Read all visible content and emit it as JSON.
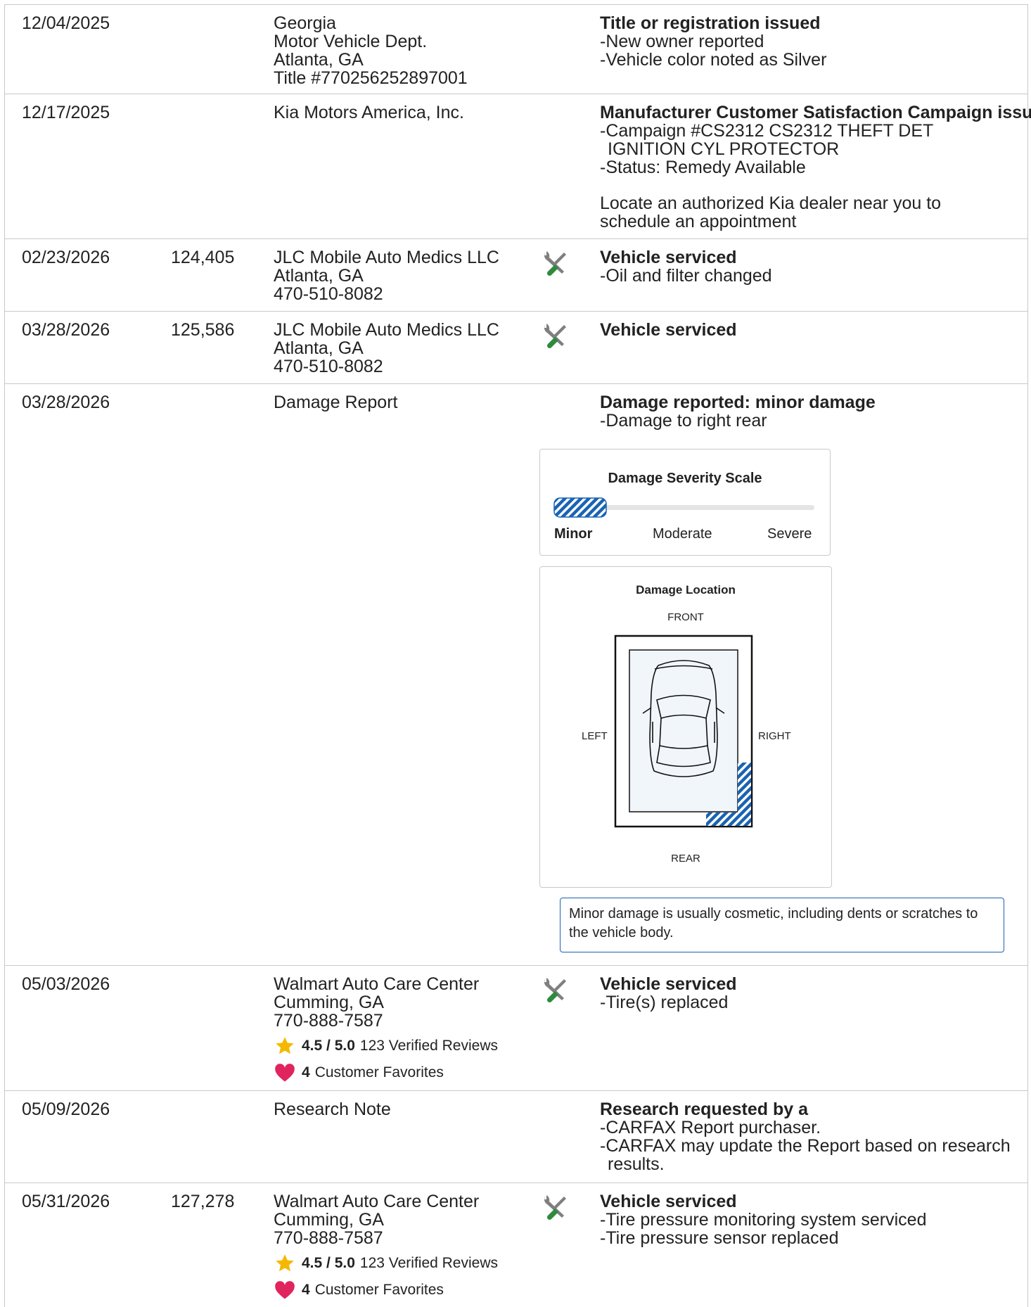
{
  "rows": [
    {
      "date": "12/04/2025",
      "odometer": "",
      "source": [
        "Georgia",
        "Motor Vehicle Dept.",
        "Atlanta, GA",
        "Title #770256252897001"
      ],
      "has_icon": false,
      "heading": "Title or registration issued",
      "bullets": [
        "New owner reported",
        "Vehicle color noted as Silver"
      ]
    },
    {
      "date": "12/17/2025",
      "odometer": "",
      "source": [
        "Kia Motors America, Inc."
      ],
      "has_icon": false,
      "heading": "Manufacturer Customer Satisfaction Campaign issued",
      "bullets": [
        "Campaign #CS2312 CS2312 THEFT DET IGNITION CYL PROTECTOR",
        "Status: Remedy Available"
      ],
      "extra": "Locate an authorized Kia dealer near you to schedule an appointment"
    },
    {
      "date": "02/23/2026",
      "odometer": "124,405",
      "source": [
        "JLC Mobile Auto Medics LLC",
        "Atlanta, GA",
        "470-510-8082"
      ],
      "has_icon": true,
      "heading": "Vehicle serviced",
      "bullets": [
        "Oil and filter changed"
      ]
    },
    {
      "date": "03/28/2026",
      "odometer": "125,586",
      "source": [
        "JLC Mobile Auto Medics LLC",
        "Atlanta, GA",
        "470-510-8082"
      ],
      "has_icon": true,
      "heading": "Vehicle serviced",
      "bullets": []
    },
    {
      "date": "03/28/2026",
      "odometer": "",
      "source": [
        "Damage Report"
      ],
      "has_icon": false,
      "heading": "Damage reported: minor damage",
      "bullets": [
        "Damage to right rear"
      ]
    },
    {
      "date": "05/03/2026",
      "odometer": "",
      "source": [
        "Walmart Auto Care Center",
        "Cumming, GA",
        "770-888-7587"
      ],
      "has_icon": true,
      "heading": "Vehicle serviced",
      "bullets": [
        "Tire(s) replaced"
      ],
      "rating": "4.5 / 5.0",
      "reviews": "123 Verified Reviews",
      "favorites_count": "4",
      "favorites_label": "Customer Favorites"
    },
    {
      "date": "05/09/2026",
      "odometer": "",
      "source": [
        "Research Note"
      ],
      "has_icon": false,
      "heading": "Research requested by a",
      "bullets": [
        "CARFAX Report purchaser.",
        "CARFAX may update the Report based on research results."
      ]
    },
    {
      "date": "05/31/2026",
      "odometer": "127,278",
      "source": [
        "Walmart Auto Care Center",
        "Cumming, GA",
        "770-888-7587"
      ],
      "has_icon": true,
      "heading": "Vehicle serviced",
      "bullets": [
        "Tire pressure monitoring system serviced",
        "Tire pressure sensor replaced"
      ],
      "rating": "4.5 / 5.0",
      "reviews": "123 Verified Reviews",
      "favorites_count": "4",
      "favorites_label": "Customer Favorites"
    }
  ],
  "damage": {
    "severity_title": "Damage Severity Scale",
    "severity_labels": [
      "Minor",
      "Moderate",
      "Severe"
    ],
    "severity_level": "Minor",
    "location_title": "Damage Location",
    "front": "FRONT",
    "rear": "REAR",
    "left": "LEFT",
    "right": "RIGHT",
    "damaged_area": "right rear",
    "note": "Minor damage is usually cosmetic, including dents or scratches to the vehicle body."
  },
  "colors": {
    "damage_blue": "#1a63b3",
    "wrench_gray": "#7f7f7f",
    "wrench_green": "#2e8b3e",
    "star": "#f5b800",
    "heart": "#e0245e",
    "border": "#c9c9c9"
  },
  "icons": [
    "tools-icon",
    "star-icon",
    "heart-icon"
  ]
}
